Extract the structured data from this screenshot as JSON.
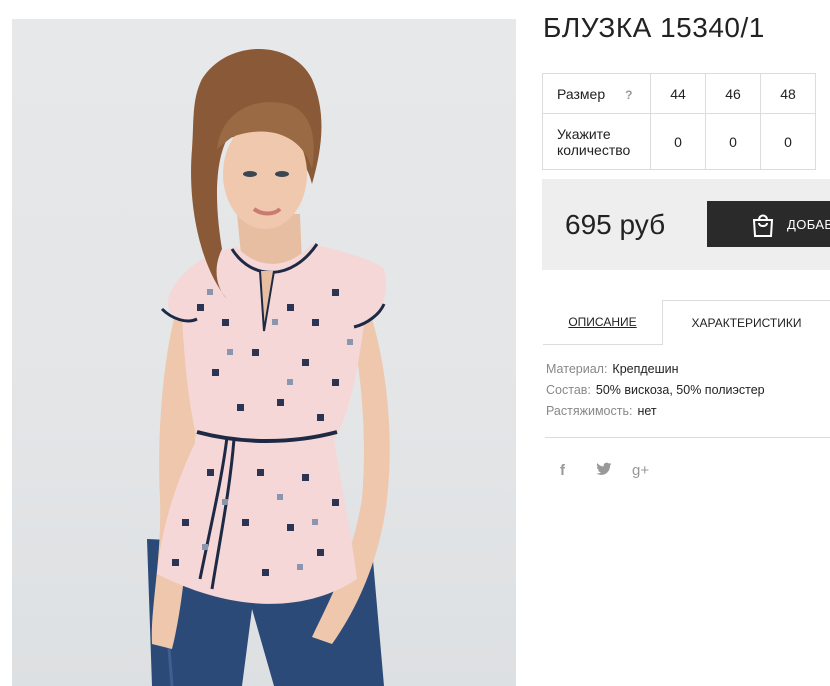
{
  "product": {
    "title": "БЛУЗКА 15340/1"
  },
  "sizes_table": {
    "size_label": "Размер",
    "help_mark": "?",
    "sizes": [
      "44",
      "46",
      "48"
    ],
    "quantity_label_line1": "Укажите",
    "quantity_label_line2": "количество",
    "quantities": [
      "0",
      "0",
      "0"
    ]
  },
  "purchase": {
    "price": "695 руб",
    "add_button_label": "ДОБАВ"
  },
  "tabs": {
    "description": "ОПИСАНИЕ",
    "characteristics": "ХАРАКТЕРИСТИКИ"
  },
  "characteristics": [
    {
      "key": "Материал:",
      "value": "Крепдешин"
    },
    {
      "key": "Состав:",
      "value": "50% вискоза, 50% полиэстер"
    },
    {
      "key": "Растяжимость:",
      "value": "нет"
    }
  ],
  "social": {
    "facebook": "f",
    "twitter": "twitter-icon",
    "googleplus": "g+"
  },
  "colors": {
    "button_bg": "#2a2a2a",
    "price_box_bg": "#eeeeee",
    "border": "#dcdcdc",
    "muted_text": "#888888"
  }
}
